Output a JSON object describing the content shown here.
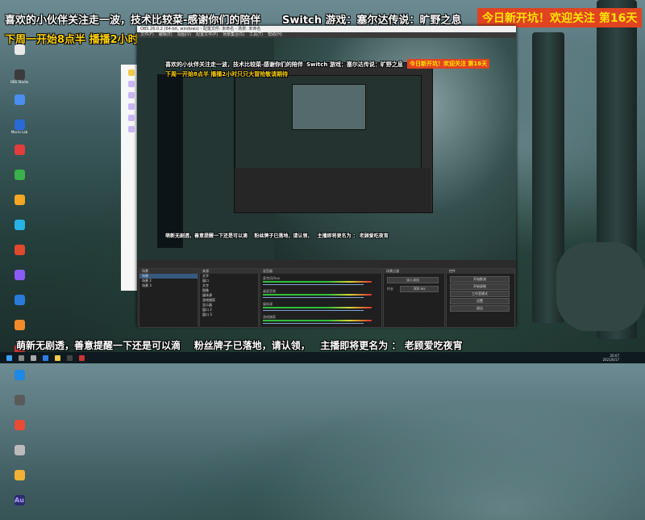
{
  "captions": {
    "top_line1": "喜欢的小伙伴关注走一波，技术比较菜-感谢你们的陪伴",
    "top_line2": "下周一开始8点半 播播2小时只只大冒险敬请期待",
    "switch_game": "Switch 游戏：塞尔达传说：旷野之息",
    "banner": "今日新开坑！欢迎关注 第16天",
    "bottom": "萌新无剧透，善意提醒一下还是可以滴    粉丝牌子已落地，请认领，   主播即将更名为 ： 老顾爱吃夜宵"
  },
  "desktop_icons": [
    {
      "label": "",
      "color": "#e8e8e8"
    },
    {
      "label": "OBS Studio",
      "color": "#3b3b3b"
    },
    {
      "label": "",
      "color": "#4a8ef0"
    },
    {
      "label": "Macro Lab",
      "color": "#2a6ad8"
    },
    {
      "label": "",
      "color": "#e23c3c"
    },
    {
      "label": "",
      "color": "#3ab14a"
    },
    {
      "label": "",
      "color": "#f5a623"
    },
    {
      "label": "",
      "color": "#27b3e6"
    },
    {
      "label": "",
      "color": "#e04a2c"
    },
    {
      "label": "",
      "color": "#8a5cf6"
    },
    {
      "label": "",
      "color": "#2a7ad8"
    },
    {
      "label": "",
      "color": "#f28c28"
    },
    {
      "label": "",
      "color": "#c33"
    },
    {
      "label": "",
      "color": "#1e88e5"
    },
    {
      "label": "",
      "color": "#5a5a5a"
    },
    {
      "label": "",
      "color": "#e94b35"
    },
    {
      "label": "",
      "color": "#bbb"
    },
    {
      "label": "",
      "color": "#f2b134"
    },
    {
      "label": "Au",
      "color": "#2a2d6e"
    }
  ],
  "obs": {
    "window_title": "OBS 26.0.2 (64-bit, windows) - 配置文件: 未命名 - 场景: 未命名",
    "menu": [
      "文件(F)",
      "编辑(E)",
      "视图(V)",
      "配置文件(P)",
      "场景集合(S)",
      "工具(T)",
      "帮助(H)"
    ],
    "panels": {
      "scenes": "场景",
      "sources": "来源",
      "mixer": "混音器",
      "transitions": "场景过渡",
      "controls": "控件"
    },
    "scene_items": [
      "场景",
      "场景 2",
      "场景 3"
    ],
    "source_items": [
      "文字",
      "窗口",
      "文字",
      "图像",
      "媒体源",
      "游戏捕获",
      "显示器",
      "窗口 2",
      "窗口 3"
    ],
    "mixer_tracks": [
      "麦克风/Aux",
      "桌面音频",
      "媒体源",
      "游戏捕获"
    ],
    "transition_value": "淡入淡出",
    "duration_label": "时长",
    "duration_value": "300 ms",
    "control_buttons": [
      "开始推流",
      "开始录制",
      "工作室模式",
      "设置",
      "退出"
    ]
  },
  "taskbar": {
    "time": "20:07",
    "date": "2021/6/17"
  }
}
